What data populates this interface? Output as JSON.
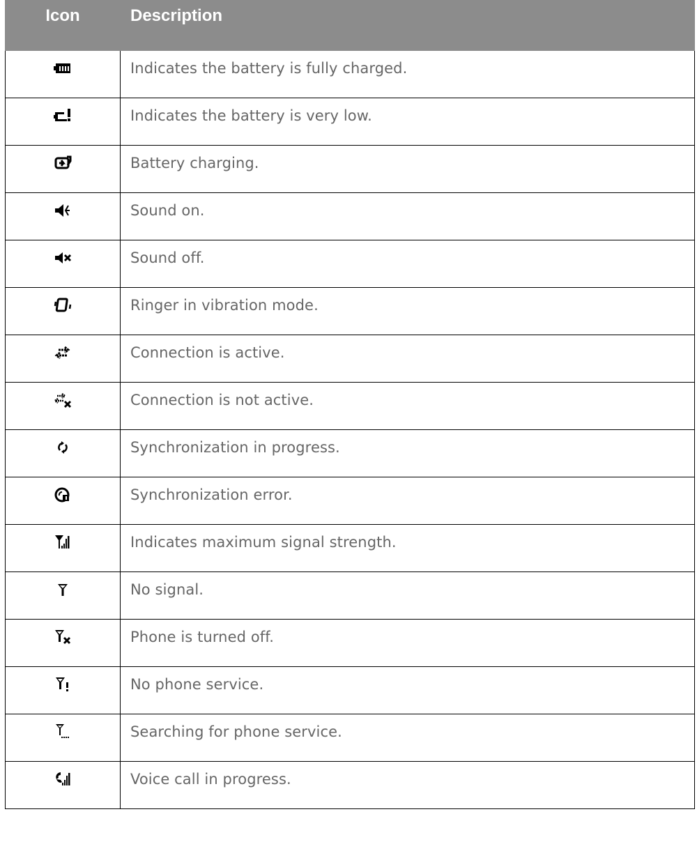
{
  "header": {
    "icon_label": "Icon",
    "description_label": "Description"
  },
  "rows": [
    {
      "icon": "battery-full-icon",
      "description": "Indicates the battery is fully charged."
    },
    {
      "icon": "battery-very-low-icon",
      "description": "Indicates the battery is very low."
    },
    {
      "icon": "battery-charging-icon",
      "description": "Battery charging."
    },
    {
      "icon": "sound-on-icon",
      "description": "Sound on."
    },
    {
      "icon": "sound-off-icon",
      "description": "Sound off."
    },
    {
      "icon": "vibration-mode-icon",
      "description": "Ringer in vibration mode."
    },
    {
      "icon": "connection-active-icon",
      "description": "Connection is active."
    },
    {
      "icon": "connection-inactive-icon",
      "description": "Connection is not active."
    },
    {
      "icon": "sync-in-progress-icon",
      "description": "Synchronization in progress."
    },
    {
      "icon": "sync-error-icon",
      "description": "Synchronization error."
    },
    {
      "icon": "signal-max-icon",
      "description": "Indicates maximum signal strength."
    },
    {
      "icon": "no-signal-icon",
      "description": "No signal."
    },
    {
      "icon": "phone-off-icon",
      "description": "Phone is turned off."
    },
    {
      "icon": "no-service-icon",
      "description": "No phone service."
    },
    {
      "icon": "searching-service-icon",
      "description": "Searching for phone service."
    },
    {
      "icon": "voice-call-icon",
      "description": "Voice call in progress."
    }
  ],
  "colors": {
    "header_bg": "#8c8c8c",
    "header_text": "#ffffff",
    "body_text": "#666666",
    "border": "#000000"
  }
}
